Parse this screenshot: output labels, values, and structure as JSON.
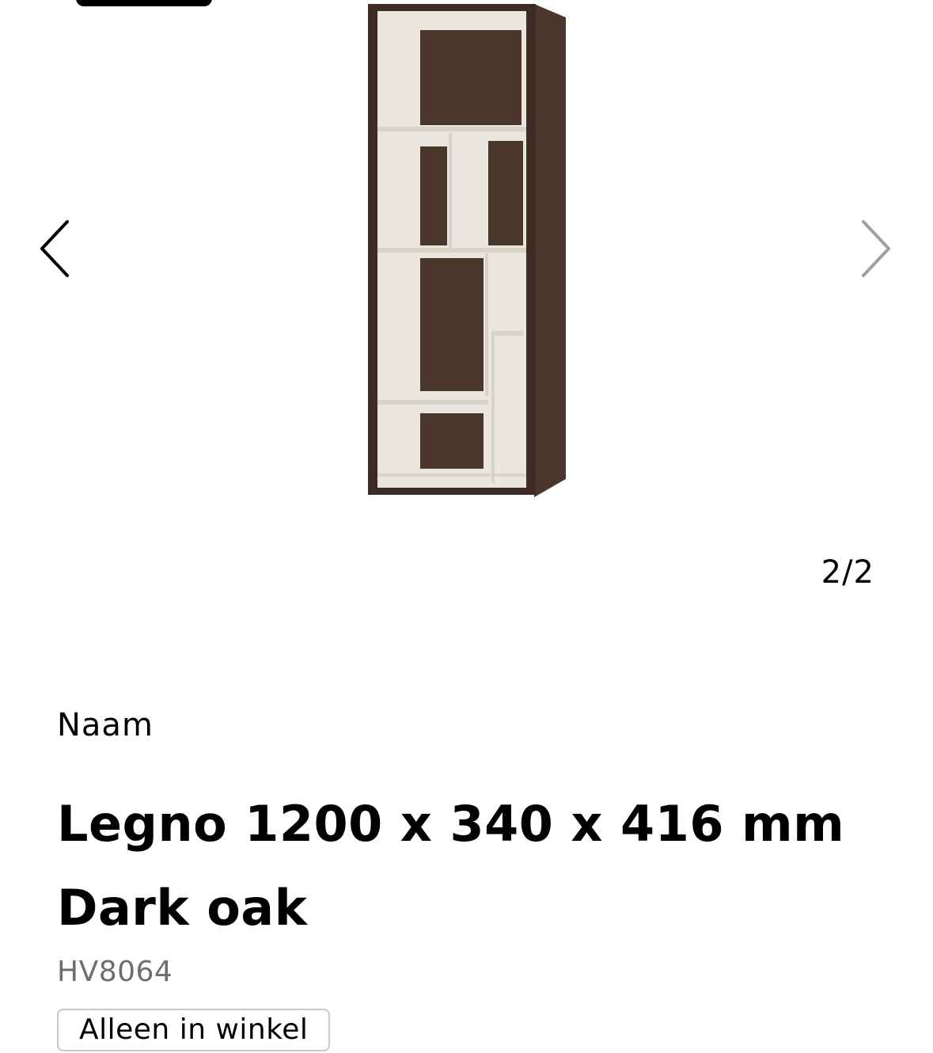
{
  "gallery": {
    "counter": "2/2",
    "prev_icon": "chevron-left-icon",
    "next_icon": "chevron-right-icon",
    "image_subject": "dark oak bookcase"
  },
  "product": {
    "name_label": "Naam",
    "title_line1": "Legno 1200 x 340 x 416 mm",
    "title_line2": "Dark oak",
    "sku": "HV8064",
    "availability_badge": "Alleen in winkel"
  },
  "colors": {
    "text": "#000000",
    "muted": "#6e6e6e",
    "badge_border": "#c8c8c8",
    "wood_dark": "#3e2c24",
    "panel_light": "#e9e4dc"
  }
}
